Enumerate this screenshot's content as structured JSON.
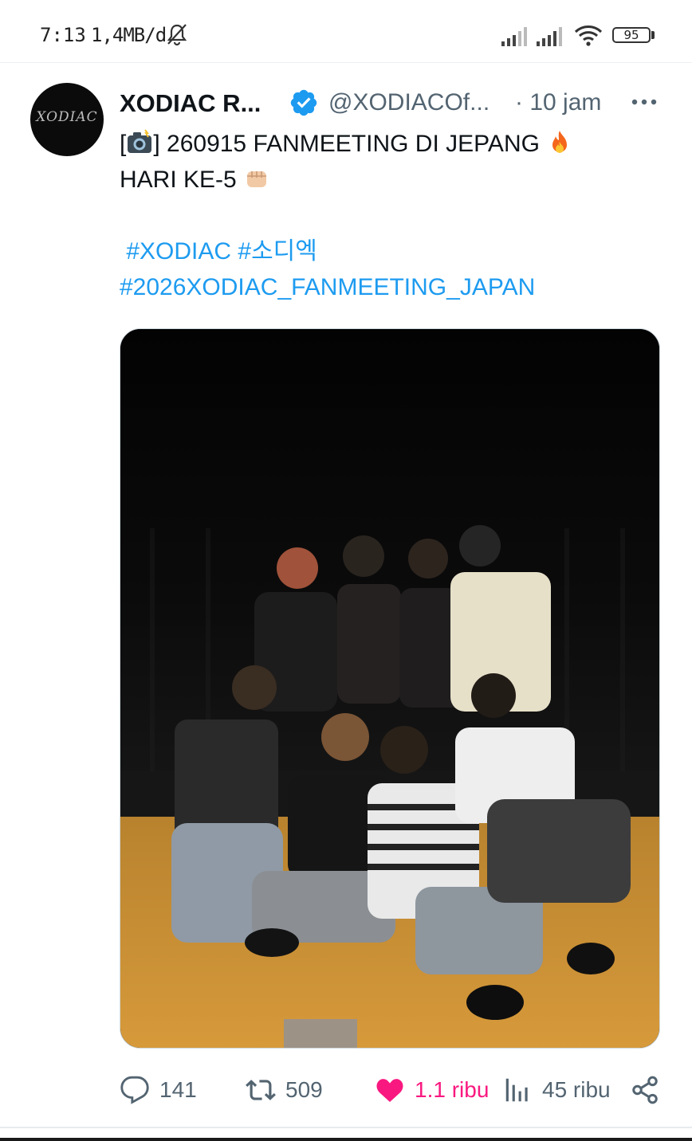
{
  "status_bar": {
    "time": "7:13",
    "data_speed": "1,4MB/d",
    "battery_level": "95"
  },
  "tweet": {
    "avatar_logo_text": "XODIAC",
    "display_name": "XODIAC R...",
    "handle": "@XODIACOf...",
    "time": "· 10 jam",
    "text_line1": "] 260915 FANMEETING DI JEPANG",
    "text_line1_prefix": "[",
    "text_line2": "HARI KE-5",
    "hashtags_line1": "#XODIAC #소디엑",
    "hashtags_line2": "#2026XODIAC_FANMEETING_JAPAN",
    "icons": [
      "camera-flash-emoji",
      "fire-emoji",
      "fist-emoji",
      "verified-badge-icon",
      "more-icon"
    ]
  },
  "actions": {
    "reply_count": "141",
    "retweet_count": "509",
    "like_count": "1.1 ribu",
    "views_count": "45 ribu",
    "colors": {
      "like_active": "#f91880",
      "muted": "#536471",
      "hashtag": "#1d9bf0",
      "verified": "#1d9bf0"
    }
  }
}
